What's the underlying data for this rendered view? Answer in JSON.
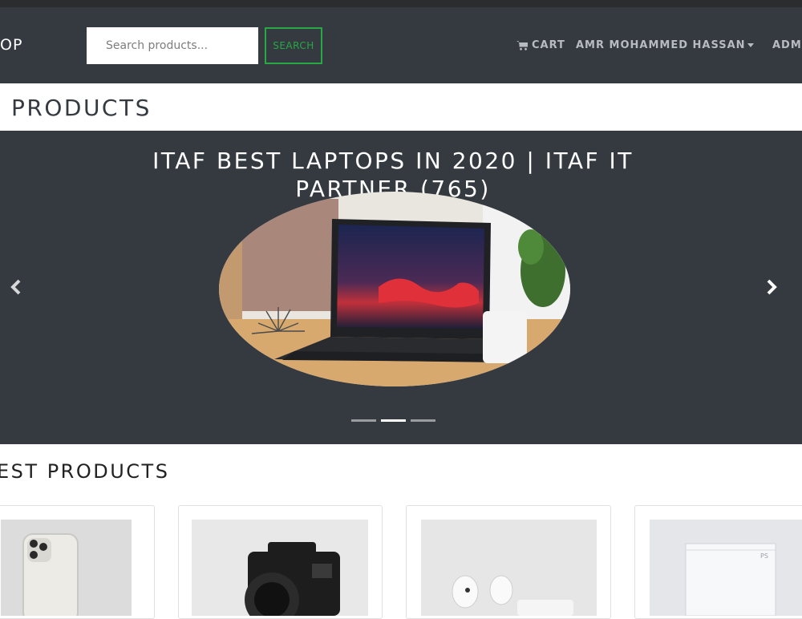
{
  "navbar": {
    "brand": "OP",
    "search": {
      "placeholder": "Search products...",
      "value": ""
    },
    "search_button": "SEARCH",
    "cart_label": "CART",
    "user_name": "AMR MOHAMMED HASSAN",
    "admin_label": "ADMI"
  },
  "page": {
    "title": "PRODUCTS"
  },
  "carousel": {
    "caption": "ITAF BEST LAPTOPS IN 2020 | ITAF IT PARTNER (765)",
    "indicator_count": 3,
    "active_index": 1
  },
  "best_products": {
    "title": "EST PRODUCTS",
    "items": [
      {
        "icon": "iphone-product-image"
      },
      {
        "icon": "camera-product-image"
      },
      {
        "icon": "airpods-product-image"
      },
      {
        "icon": "playstation-product-image"
      }
    ]
  },
  "colors": {
    "navbar_bg": "#343a40",
    "accent_green": "#28a745",
    "carousel_bg": "#343a40"
  }
}
